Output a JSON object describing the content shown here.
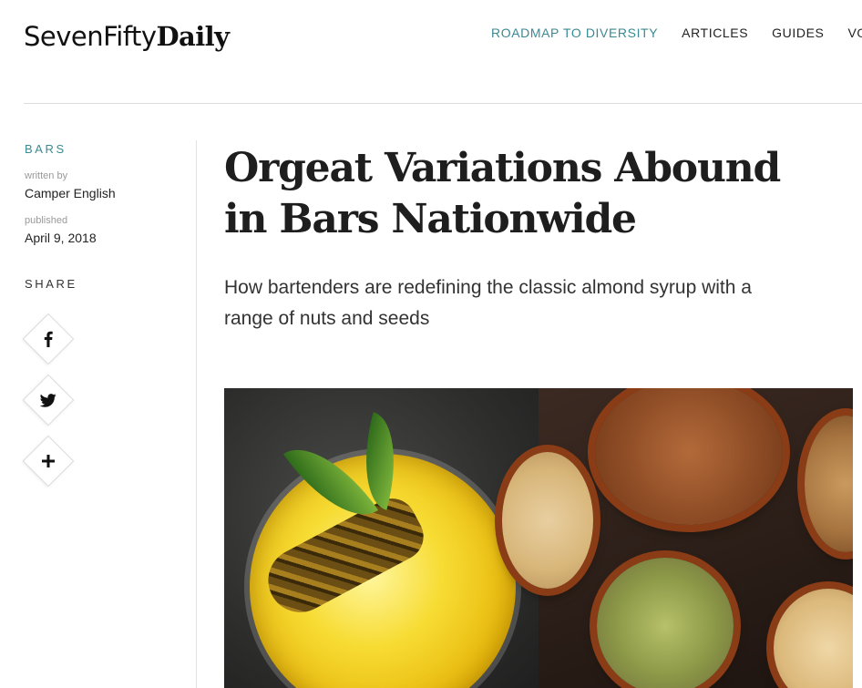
{
  "header": {
    "logo_seven": "SevenFifty",
    "logo_daily": "Daily",
    "nav": [
      {
        "label": "ROADMAP TO DIVERSITY",
        "active": true
      },
      {
        "label": "ARTICLES",
        "active": false
      },
      {
        "label": "GUIDES",
        "active": false
      },
      {
        "label": "VO",
        "active": false
      }
    ]
  },
  "meta": {
    "category": "BARS",
    "author_label": "written by",
    "author": "Camper English",
    "published_label": "published",
    "date": "April 9, 2018",
    "share_label": "SHARE",
    "share_buttons": [
      {
        "icon": "facebook-icon",
        "glyph": "f"
      },
      {
        "icon": "twitter-icon",
        "glyph": "🐦"
      },
      {
        "icon": "plus-icon",
        "glyph": "+"
      }
    ]
  },
  "article": {
    "title_line1": "Orgeat Variations Abound",
    "title_line2": "in Bars Nationwide",
    "subtitle_line1": "How bartenders are redefining the classic almond syrup with a",
    "subtitle_line2": "range of nuts and seeds"
  },
  "colors": {
    "accent": "#3a8a93",
    "text": "#222222"
  }
}
